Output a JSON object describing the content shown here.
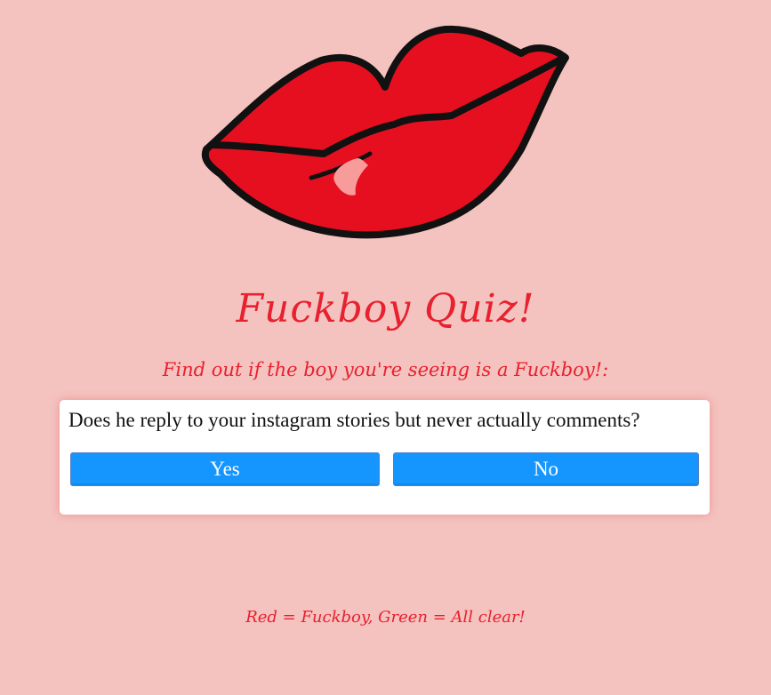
{
  "header": {
    "logo_icon": "lips-icon",
    "title": "Fuckboy Quiz!",
    "subtitle": "Find out if the boy you're seeing is a Fuckboy!:"
  },
  "quiz": {
    "question": "Does he reply to your instagram stories but never actually comments?",
    "yes_label": "Yes",
    "no_label": "No"
  },
  "footer": {
    "legend": "Red = Fuckboy, Green = All clear!"
  },
  "colors": {
    "background": "#f4c3bf",
    "accent_red": "#e8202f",
    "lip_red": "#e60f1f",
    "button_blue": "#1596ff"
  }
}
